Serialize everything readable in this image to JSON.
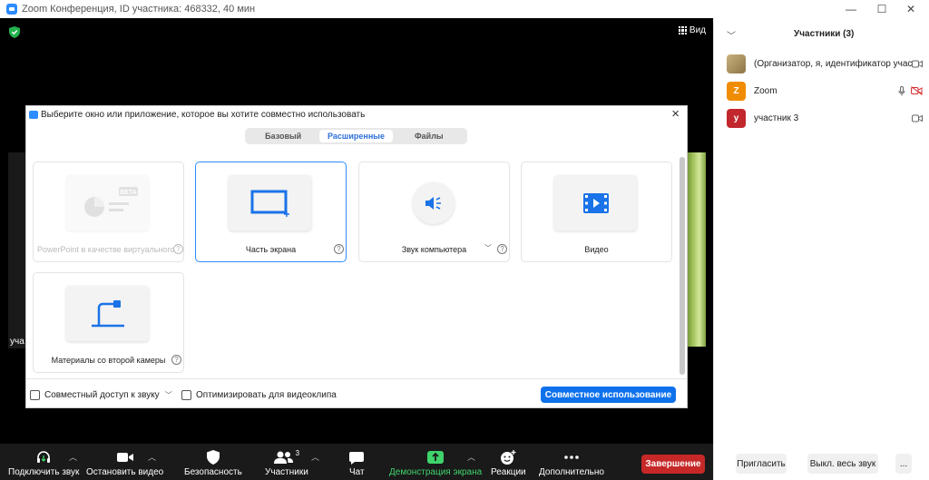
{
  "window": {
    "title": "Zoom Конференция, ID участника: 468332, 40 мин",
    "minimize": "—",
    "maximize": "☐",
    "close": "✕"
  },
  "meeting": {
    "view_label": "Вид",
    "left_tile_label": "уча"
  },
  "toolbar": {
    "audio": "Подключить звук",
    "video": "Остановить видео",
    "security": "Безопасность",
    "participants": "Участники",
    "participants_count": "3",
    "chat": "Чат",
    "share": "Демонстрация экрана",
    "reactions": "Реакции",
    "more": "Дополнительно",
    "end": "Завершение",
    "accent_share": "#3fd36b",
    "end_color": "#c62828"
  },
  "participants_panel": {
    "title": "Участники (3)",
    "participants": [
      {
        "name": "(Организатор, я, идентификатор участника)",
        "avatar_letter": "",
        "avatar_color": "#b59a64"
      },
      {
        "name": "Zoom",
        "avatar_letter": "Z",
        "avatar_color": "#f08c00"
      },
      {
        "name": "участник 3",
        "avatar_letter": "у",
        "avatar_color": "#c1272d"
      }
    ],
    "invite": "Пригласить",
    "mute_all": "Выкл. весь звук",
    "more": "..."
  },
  "share_dialog": {
    "title": "Выберите окно или приложение, которое вы хотите совместно использовать",
    "tabs": [
      {
        "label": "Базовый",
        "active": false
      },
      {
        "label": "Расширенные",
        "active": true
      },
      {
        "label": "Файлы",
        "active": false
      }
    ],
    "options": [
      {
        "label": "PowerPoint в качестве виртуального",
        "badge": "BETA",
        "disabled": true
      },
      {
        "label": "Часть экрана",
        "selected": true
      },
      {
        "label": "Звук компьютера"
      },
      {
        "label": "Видео"
      },
      {
        "label": "Материалы со второй камеры"
      }
    ],
    "help_glyph": "?",
    "share_audio": "Совместный доступ к звуку",
    "optimize_video": "Оптимизировать для видеоклипа",
    "share_button": "Совместное использование",
    "accent": "#2d8cff"
  }
}
